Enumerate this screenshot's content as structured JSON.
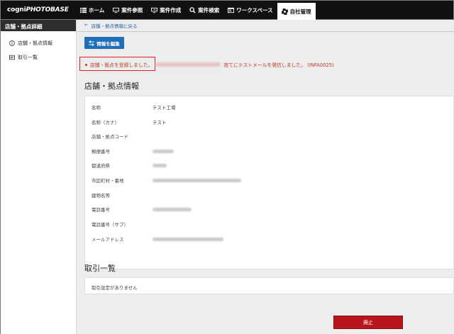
{
  "header": {
    "logo_prefix": "cogni",
    "logo_suffix": "PHOTOBASE",
    "nav": [
      {
        "label": "ホーム",
        "icon": "list-icon"
      },
      {
        "label": "案件参照",
        "icon": "monitor-icon"
      },
      {
        "label": "案件作成",
        "icon": "monitor-edit-icon"
      },
      {
        "label": "案件検索",
        "icon": "search-icon"
      },
      {
        "label": "ワークスペース",
        "icon": "workspace-icon"
      },
      {
        "label": "自社管理",
        "icon": "gear-icon"
      }
    ]
  },
  "sidebar": {
    "title": "店舗・拠点詳細",
    "items": [
      {
        "label": "店舗・拠点情報",
        "icon": "info-circle-icon"
      },
      {
        "label": "取引一覧",
        "icon": "list-card-icon"
      }
    ]
  },
  "main": {
    "back_link": "店舗・拠点情報に戻る",
    "back_arrow": "←",
    "edit_button": "情報を編集",
    "alert": {
      "part1": "店舗・拠点を登録しました。",
      "part2": "宛てにテストメールを発信しました。 (INFA0025)"
    },
    "info_title": "店舗・拠点情報",
    "fields": [
      {
        "label": "名称",
        "value": "テスト工場"
      },
      {
        "label": "名称（カナ）",
        "value": "テスト"
      },
      {
        "label": "店舗・拠点コード",
        "value": ""
      },
      {
        "label": "郵便番号",
        "value": ""
      },
      {
        "label": "都道府県",
        "value": ""
      },
      {
        "label": "市区町村・番地",
        "value": ""
      },
      {
        "label": "建物名等",
        "value": ""
      },
      {
        "label": "電話番号",
        "value": ""
      },
      {
        "label": "電話番号（サブ）",
        "value": ""
      },
      {
        "label": "メールアドレス",
        "value": ""
      }
    ],
    "trade_title": "取引一覧",
    "trade_empty": "取引設定がありません",
    "stop_button": "廃止"
  }
}
